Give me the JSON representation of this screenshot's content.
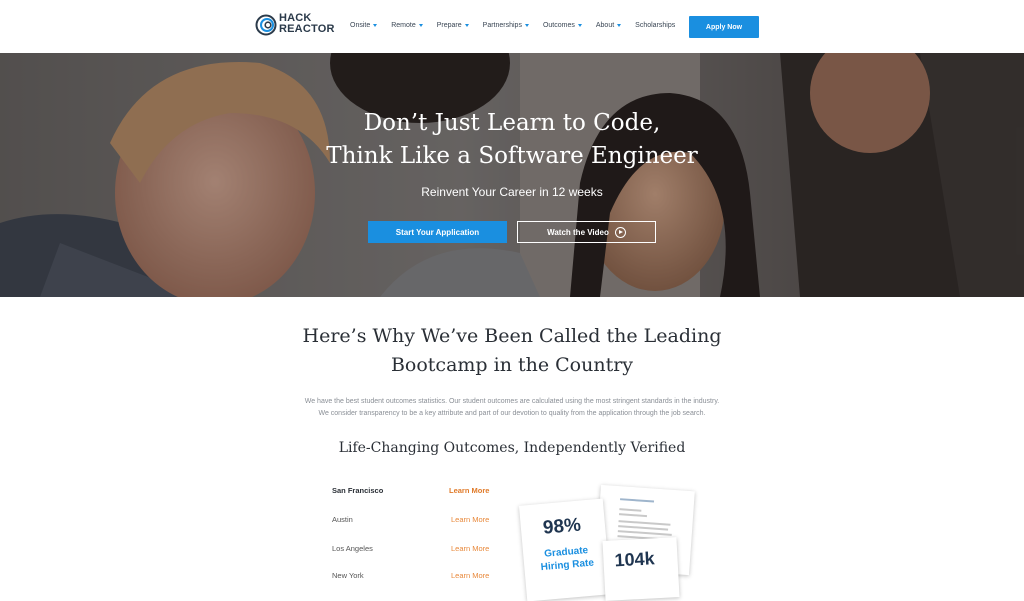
{
  "header": {
    "logo_text_1": "HACK",
    "logo_text_2": "REACTOR",
    "nav": [
      {
        "label": "Onsite",
        "has_caret": true
      },
      {
        "label": "Remote",
        "has_caret": true
      },
      {
        "label": "Prepare",
        "has_caret": true
      },
      {
        "label": "Partnerships",
        "has_caret": true
      },
      {
        "label": "Outcomes",
        "has_caret": true
      },
      {
        "label": "About",
        "has_caret": true
      },
      {
        "label": "Scholarships",
        "has_caret": false
      }
    ],
    "apply_label": "Apply Now"
  },
  "hero": {
    "title_line1": "Don’t Just Learn to Code,",
    "title_line2": "Think Like a Software Engineer",
    "subtitle": "Reinvent Your Career in 12 weeks",
    "primary_button": "Start Your Application",
    "secondary_button": "Watch the Video",
    "secondary_icon": "play-icon"
  },
  "main": {
    "title_line1": "Here’s Why We’ve Been Called the Leading",
    "title_line2": "Bootcamp in the Country",
    "desc_line1": "We have the best student outcomes statistics. Our student outcomes are calculated using the most stringent standards in the industry.",
    "desc_line2": "We consider transparency to be a key attribute and part of our devotion to quality from the application through the job search.",
    "outcomes_title": "Life-Changing Outcomes, Independently Verified",
    "cities": [
      {
        "name": "San Francisco",
        "link": "Learn More"
      },
      {
        "name": "Austin",
        "link": "Learn More"
      },
      {
        "name": "Los Angeles",
        "link": "Learn More"
      },
      {
        "name": "New York",
        "link": "Learn More"
      }
    ],
    "stats": {
      "hiring_rate_value": "98%",
      "hiring_rate_label_1": "Graduate",
      "hiring_rate_label_2": "Hiring Rate",
      "salary_value": "104k"
    }
  },
  "colors": {
    "accent": "#1a8fe0",
    "link": "#e8883a",
    "heading": "#2a2f36"
  }
}
